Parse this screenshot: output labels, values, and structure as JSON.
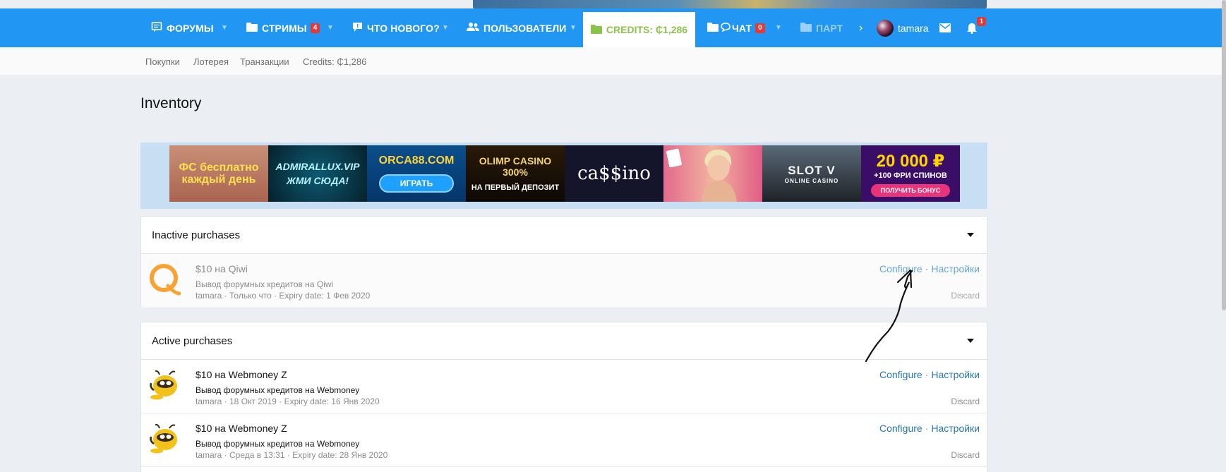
{
  "nav": {
    "forums": "ФОРУМЫ",
    "streams": "СТРИМЫ",
    "streams_badge": "4",
    "whats_new": "ЧТО НОВОГО?",
    "users": "ПОЛЬЗОВАТЕЛИ",
    "credits": "CREDITS: ₵1,286",
    "chat": "ЧАТ",
    "chat_badge": "0",
    "partners": "ПАРТ",
    "username": "tamara",
    "notifications_badge": "1"
  },
  "subnav": [
    "Покупки",
    "Лотерея",
    "Транзакции",
    "Credits: ₵1,286"
  ],
  "page_title": "Inventory",
  "ads": [
    {
      "text": "ФС бесплатно каждый день"
    },
    {
      "text": "ADMIRALLUX.VIP ЖМИ СЮДА!"
    },
    {
      "text": "ORCA88.COM",
      "button": "ИГРАТЬ"
    },
    {
      "text": "OLIMP CASINO 300%",
      "sub": "НА ПЕРВЫЙ ДЕПОЗИТ"
    },
    {
      "text": "ca$$ino"
    },
    {
      "text": ""
    },
    {
      "text": "SLOT V",
      "sub": "ONLINE CASINO"
    },
    {
      "text": "20 000 ₽",
      "sub": "+100 ФРИ СПИНОВ",
      "button": "ПОЛУЧИТЬ БОНУС"
    }
  ],
  "inactive": {
    "title": "Inactive purchases",
    "items": [
      {
        "title": "$10 на Qiwi",
        "desc": "Вывод форумных кредитов на Qiwi",
        "meta": "tamara · Только что · Expiry date: 1 Фев 2020",
        "configure": "Configure",
        "settings": "Настройки",
        "discard": "Discard"
      }
    ]
  },
  "active": {
    "title": "Active purchases",
    "items": [
      {
        "title": "$10 на Webmoney Z",
        "desc": "Вывод форумных кредитов на Webmoney",
        "meta": "tamara · 18 Окт 2019 · Expiry date: 16 Янв 2020",
        "configure": "Configure",
        "settings": "Настройки",
        "discard": "Discard"
      },
      {
        "title": "$10 на Webmoney Z",
        "desc": "Вывод форумных кредитов на Webmoney",
        "meta": "tamara · Среда в 13:31 · Expiry date: 28 Янв 2020",
        "configure": "Configure",
        "settings": "Настройки",
        "discard": "Discard"
      }
    ]
  },
  "colors": {
    "nav_bg": "#2196f3",
    "credits_green": "#8bc34a",
    "link_blue": "#2577b1",
    "badge_red": "#e53935"
  }
}
